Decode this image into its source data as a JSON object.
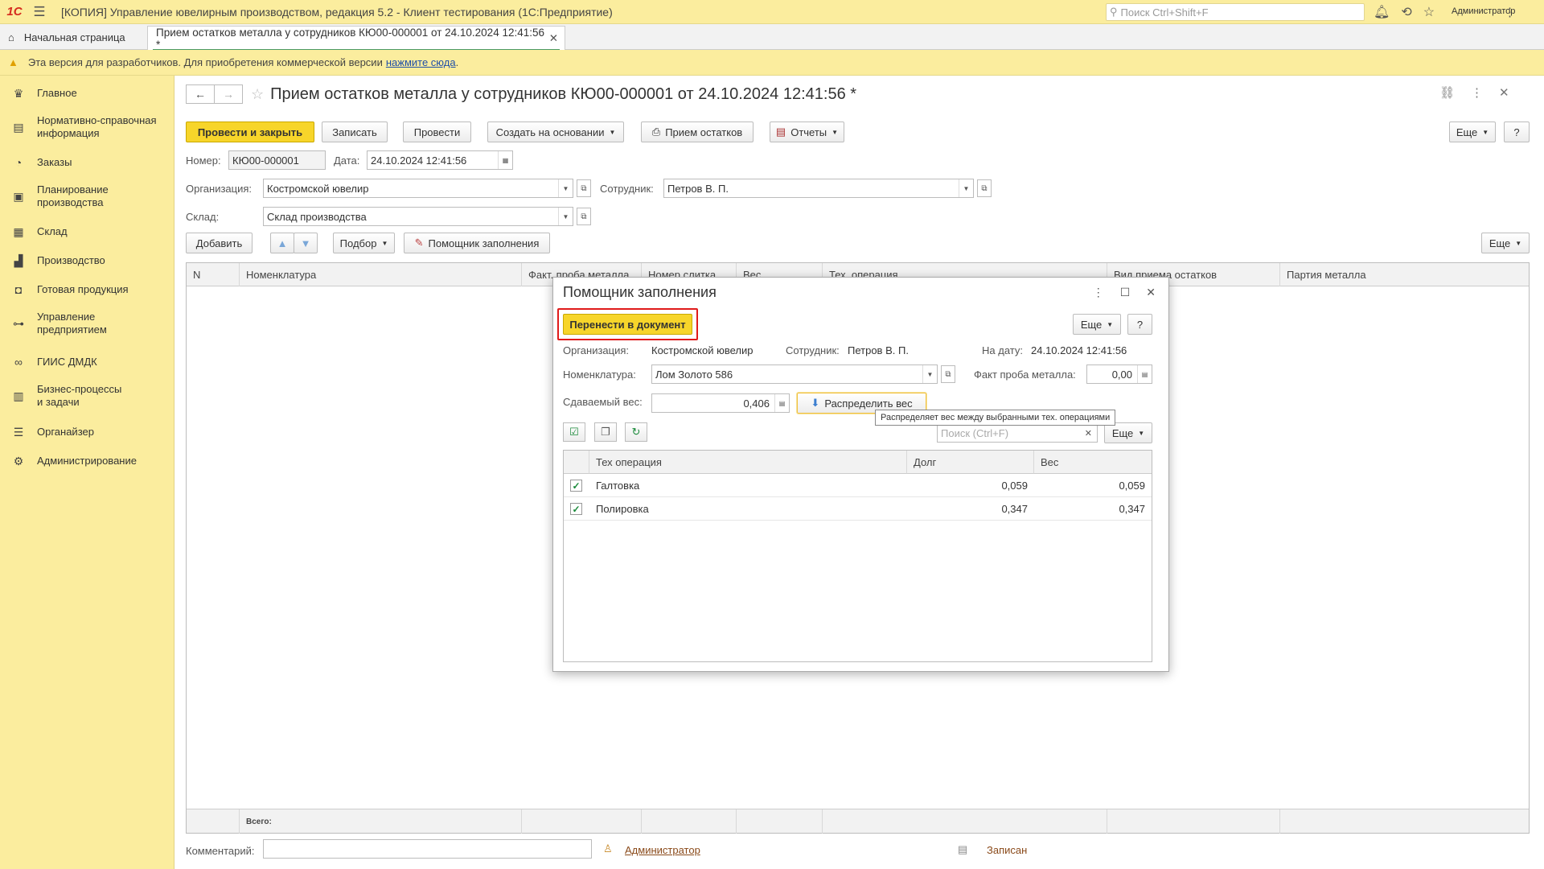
{
  "app": {
    "logo": "1С",
    "title": "[КОПИЯ] Управление ювелирным производством, редакция 5.2  - Клиент тестирования (1С:Предприятие)",
    "search_placeholder": "Поиск Ctrl+Shift+F",
    "user": "Администратор"
  },
  "tabs": {
    "home": "Начальная страница",
    "doc": "Прием остатков металла у сотрудников КЮ00-000001 от 24.10.2024 12:41:56 *"
  },
  "warning": {
    "text": "Эта версия для разработчиков. Для приобретения коммерческой версии",
    "link": "нажмите сюда",
    "tail": "."
  },
  "sidebar": {
    "items": [
      {
        "label": "Главное",
        "icon": "crown-icon"
      },
      {
        "label": "Нормативно-справочная информация",
        "icon": "book-icon"
      },
      {
        "label": "Заказы",
        "icon": "pie-icon"
      },
      {
        "label": "Планирование производства",
        "icon": "clipboard-icon"
      },
      {
        "label": "Склад",
        "icon": "grid-icon"
      },
      {
        "label": "Производство",
        "icon": "factory-icon"
      },
      {
        "label": "Готовая продукция",
        "icon": "bag-icon"
      },
      {
        "label": "Управление предприятием",
        "icon": "org-icon"
      },
      {
        "label": "ГИИС ДМДК",
        "icon": "link-icon"
      },
      {
        "label": "Бизнес-процессы и задачи",
        "icon": "tasks-icon"
      },
      {
        "label": "Органайзер",
        "icon": "list-icon"
      },
      {
        "label": "Администрирование",
        "icon": "gear-icon"
      }
    ]
  },
  "form": {
    "title": "Прием остатков металла у сотрудников КЮ00-000001 от 24.10.2024 12:41:56 *",
    "toolbar": {
      "post_close": "Провести и закрыть",
      "save": "Записать",
      "post": "Провести",
      "create_based": "Создать на основании",
      "print": "Прием остатков",
      "reports": "Отчеты",
      "more": "Еще",
      "help": "?"
    },
    "number_label": "Номер:",
    "number": "КЮ00-000001",
    "date_label": "Дата:",
    "date": "24.10.2024 12:41:56",
    "org_label": "Организация:",
    "org": "Костромской ювелир",
    "employee_label": "Сотрудник:",
    "employee": "Петров В. П.",
    "warehouse_label": "Склад:",
    "warehouse": "Склад производства",
    "table_toolbar": {
      "add": "Добавить",
      "pick": "Подбор",
      "helper": "Помощник заполнения",
      "more": "Еще"
    },
    "columns": [
      "N",
      "Номенклатура",
      "Факт. проба металла",
      "Номер слитка",
      "Вес",
      "Тех. операция",
      "Вид приема остатков",
      "Партия металла"
    ],
    "total_label": "Всего:",
    "comment_label": "Комментарий:",
    "comment": "",
    "author": "Администратор",
    "status": "Записан"
  },
  "dialog": {
    "title": "Помощник заполнения",
    "transfer_btn": "Перенести в документ",
    "more": "Еще",
    "help": "?",
    "org_label": "Организация:",
    "org": "Костромской ювелир",
    "employee_label": "Сотрудник:",
    "employee": "Петров В. П.",
    "date_label": "На дату:",
    "date": "24.10.2024 12:41:56",
    "nom_label": "Номенклатура:",
    "nom": "Лом Золото  586",
    "probe_label": "Факт проба металла:",
    "probe": "0,00",
    "weight_label": "Сдаваемый вес:",
    "weight": "0,406",
    "distribute_btn": "Распределить вес",
    "tooltip": "Распределяет вес между выбранными тех. операциями",
    "search_placeholder": "Поиск (Ctrl+F)",
    "list_more": "Еще",
    "columns": [
      "Тех операция",
      "Долг",
      "Вес"
    ],
    "rows": [
      {
        "op": "Галтовка",
        "debt": "0,059",
        "weight": "0,059",
        "checked": true
      },
      {
        "op": "Полировка",
        "debt": "0,347",
        "weight": "0,347",
        "checked": true
      }
    ]
  },
  "colors": {
    "accent_yellow": "#fbed9e",
    "button_yellow": "#f7d52a",
    "highlight_red": "#e01b1b",
    "check_green": "#1a8a3a"
  }
}
